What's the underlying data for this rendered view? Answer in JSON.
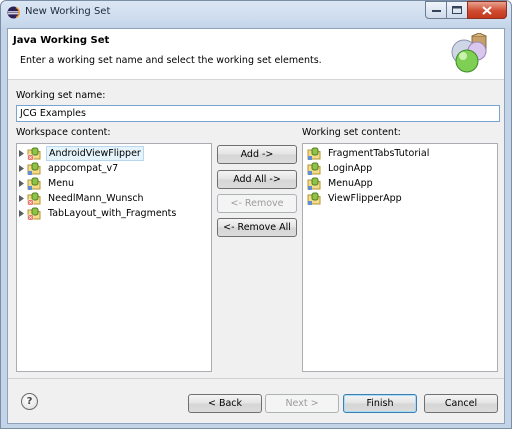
{
  "window": {
    "title": "New Working Set"
  },
  "header": {
    "title": "Java Working Set",
    "description": "Enter a working set name and select the working set elements."
  },
  "name_field": {
    "label": "Working set name:",
    "value": "JCG Examples"
  },
  "workspace": {
    "label": "Workspace content:",
    "items": [
      {
        "label": "AndroidViewFlipper",
        "icon": "android-project-icon-error",
        "selected": true
      },
      {
        "label": "appcompat_v7",
        "icon": "android-project-icon"
      },
      {
        "label": "Menu",
        "icon": "android-project-icon"
      },
      {
        "label": "NeedlMann_Wunsch",
        "icon": "android-project-icon-error"
      },
      {
        "label": "TabLayout_with_Fragments",
        "icon": "android-project-icon-error"
      }
    ]
  },
  "working_set": {
    "label": "Working set content:",
    "items": [
      {
        "label": "FragmentTabsTutorial",
        "icon": "android-project-icon"
      },
      {
        "label": "LoginApp",
        "icon": "android-project-icon"
      },
      {
        "label": "MenuApp",
        "icon": "android-project-icon"
      },
      {
        "label": "ViewFlipperApp",
        "icon": "android-project-icon"
      }
    ]
  },
  "transfer_buttons": {
    "add": "Add ->",
    "add_all": "Add All ->",
    "remove": "<- Remove",
    "remove_all": "<- Remove All"
  },
  "footer": {
    "help": "?",
    "back": "< Back",
    "next": "Next >",
    "finish": "Finish",
    "cancel": "Cancel"
  },
  "colors": {
    "selection": "#e5f3fb",
    "accent": "#3c7fb1",
    "close": "#c3381d"
  }
}
